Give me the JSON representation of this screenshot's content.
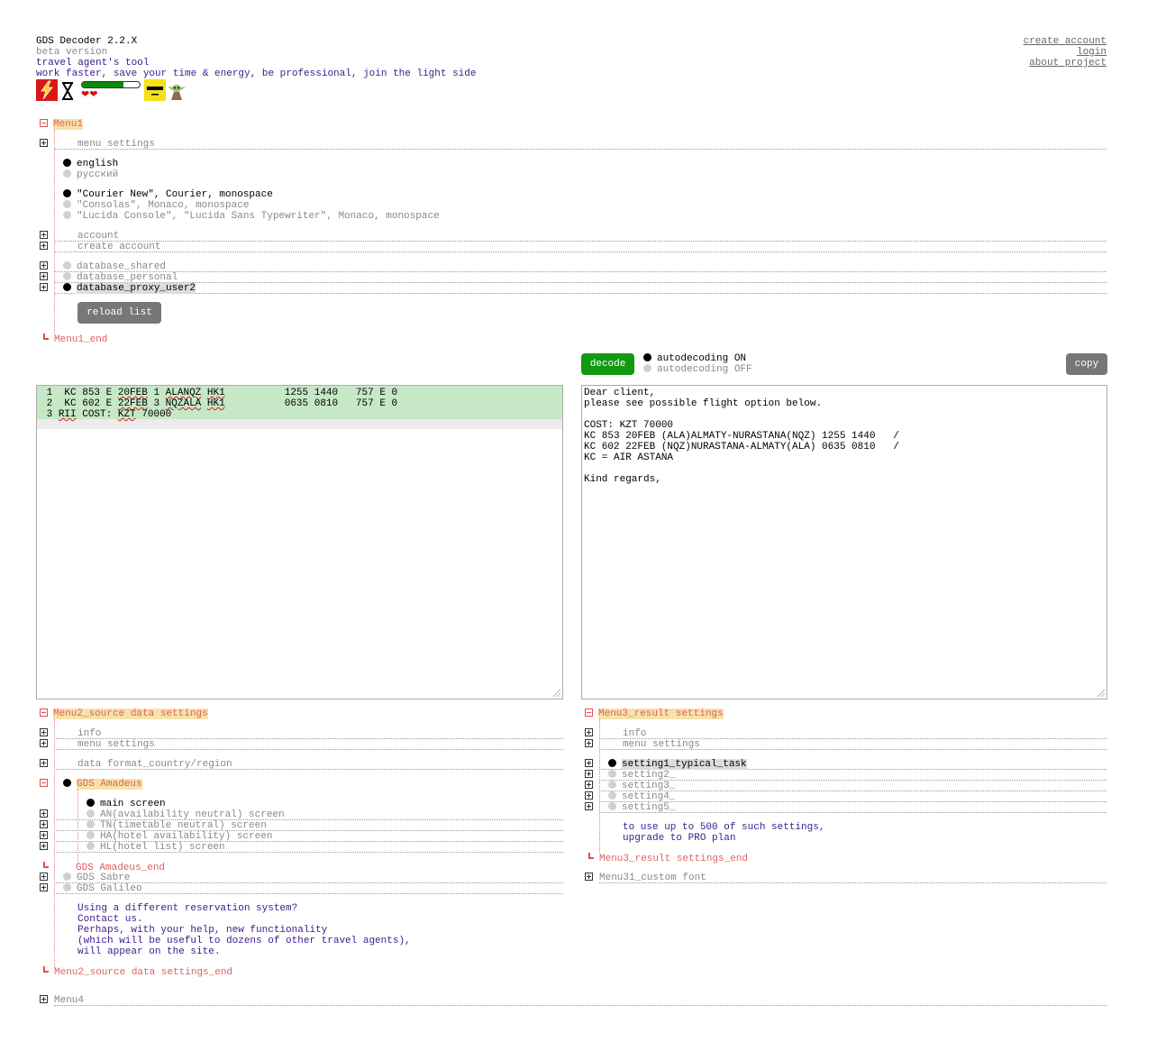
{
  "header": {
    "title": "GDS Decoder 2.2.X",
    "subtitle": "beta version",
    "tagline": "travel agent's tool",
    "motto": "work faster, save your time & energy, be professional, join the light side",
    "links": [
      "create account",
      "login",
      "about project"
    ],
    "progress_fraction": 0.72,
    "hearts": "❤❤"
  },
  "menu1": {
    "label": "Menu1",
    "menu_settings": "menu settings",
    "languages": [
      "english",
      "русский"
    ],
    "language_selected": "english",
    "fonts": [
      "\"Courier New\", Courier, monospace",
      "\"Consolas\", Monaco, monospace",
      "\"Lucida Console\", \"Lucida Sans Typewriter\", Monaco, monospace"
    ],
    "account": "account",
    "create_account": "create account",
    "databases": [
      "database_shared",
      "database_personal",
      "database_proxy_user2"
    ],
    "reload_label": "reload list",
    "end_label": "Menu1_end"
  },
  "decoder": {
    "decode_label": "decode",
    "autodecoding_on": "autodecoding ON",
    "autodecoding_off": "autodecoding OFF",
    "copy_label": "copy",
    "source_lines": [
      {
        "num": "1",
        "a": "KC 853 E ",
        "b": "20FEB",
        "c": " 1 ",
        "d": "ALANQZ",
        "e": " ",
        "f": "HK1",
        "g": "          1255 1440   757 E 0"
      },
      {
        "num": "2",
        "a": "KC 602 E ",
        "b": "22FEB",
        "c": " 3 ",
        "d": "NQZALA",
        "e": " ",
        "f": "HK1",
        "g": "          0635 0810   757 E 0"
      }
    ],
    "source_line3": {
      "num": "3",
      "a": "RII",
      "b": " COST: ",
      "c": "KZT",
      "d": " 70000"
    },
    "result_text": "Dear client,\nplease see possible flight option below.\n\nCOST: KZT 70000\nKC 853 20FEB (ALA)ALMATY-NURASTANA(NQZ) 1255 1440   /\nKC 602 22FEB (NQZ)NURASTANA-ALMATY(ALA) 0635 0810   /\nKC = AIR ASTANA\n\nKind regards,"
  },
  "menu2": {
    "label": "Menu2_source data settings",
    "info": "info",
    "menu_settings": "menu settings",
    "data_format": "data format_country/region",
    "gds_amadeus": "GDS Amadeus",
    "amadeus_items": [
      "main screen",
      "AN(availability neutral) screen",
      "TN(timetable neutral) screen",
      "HA(hotel availability) screen",
      "HL(hotel list) screen"
    ],
    "amadeus_end": "GDS Amadeus_end",
    "gds_sabre": "GDS Sabre",
    "gds_galileo": "GDS Galileo",
    "note_lines": [
      "Using a different reservation system?",
      "Contact us.",
      "Perhaps, with your help, new functionality",
      "(which will be useful to dozens of other travel agents),",
      "will appear on the site."
    ],
    "end_label": "Menu2_source data settings_end"
  },
  "menu3": {
    "label": "Menu3_result settings",
    "info": "info",
    "menu_settings": "menu settings",
    "settings": [
      "setting1_typical_task",
      "setting2_",
      "setting3_",
      "setting4_",
      "setting5_"
    ],
    "upgrade_lines": [
      "to use up to 500 of such settings,",
      "upgrade to PRO plan"
    ],
    "end_label": "Menu3_result settings_end",
    "custom_font": "Menu31_custom font"
  },
  "menu4": {
    "label": "Menu4"
  },
  "colors": {
    "decode_green": "#119911",
    "button_gray": "#777777",
    "source_highlight": "#c7e8c7",
    "menu_label_bg": "#f6e3a8",
    "link_purple": "#3c1a8c"
  }
}
